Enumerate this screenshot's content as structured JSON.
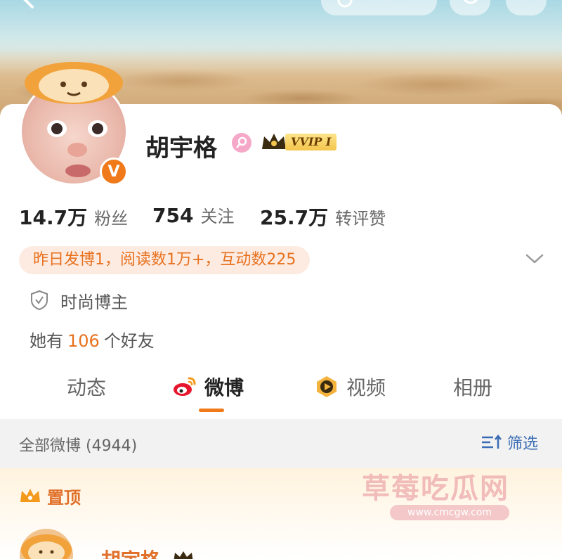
{
  "header": {
    "top_pill_text": ""
  },
  "profile": {
    "name": "胡宇格",
    "vip_label": "VVIP I",
    "verified_mark": "V",
    "stats": [
      {
        "value": "14.7万",
        "label": "粉丝"
      },
      {
        "value": "754",
        "label": "关注"
      },
      {
        "value": "25.7万",
        "label": "转评赞"
      }
    ],
    "activity": "昨日发博1，阅读数1万+，互动数225",
    "tag": "时尚博主",
    "friends": {
      "prefix": "她有",
      "count": "106",
      "suffix": "个好友"
    }
  },
  "tabs": [
    {
      "label": "动态",
      "icon": ""
    },
    {
      "label": "微博",
      "icon": "weibo-logo-icon",
      "active": true
    },
    {
      "label": "视频",
      "icon": "video-play-icon"
    },
    {
      "label": "相册",
      "icon": ""
    }
  ],
  "feed": {
    "title": "全部微博 (4944)",
    "filter_label": "筛选",
    "pinned_label": "置顶",
    "first_post_author": "胡宇格"
  },
  "watermark": {
    "title": "草莓吃瓜网",
    "url": "www.cmcgw.com"
  },
  "colors": {
    "accent": "#f07a1a",
    "link": "#3a6db5",
    "activity_bg": "#fdebe2"
  }
}
